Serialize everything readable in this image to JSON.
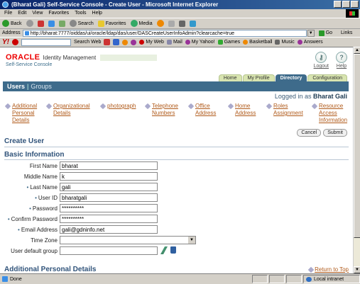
{
  "window": {
    "title": "(Bharat Gali) Self-Service Console - Create User - Microsoft Internet Explorer"
  },
  "menu": [
    "File",
    "Edit",
    "View",
    "Favorites",
    "Tools",
    "Help"
  ],
  "toolbar": {
    "back": "Back",
    "search": "Search",
    "favorites": "Favorites",
    "media": "Media"
  },
  "address": {
    "label": "Address",
    "url": "http://bharat:7777/oiddas/ui/oracle/ldap/das/user/DASCreateUserInfoAdmin?clearcache=true",
    "go": "Go",
    "links": "Links"
  },
  "yahoo": {
    "search_web": "Search Web",
    "my_web": "My Web",
    "mail": "Mail",
    "my_yahoo": "My Yahoo!",
    "games": "Games",
    "basketball": "Basketball",
    "music": "Music",
    "answers": "Answers"
  },
  "app": {
    "brand_oracle": "ORACLE",
    "brand_product": "Identity Management",
    "console": "Self-Service Console",
    "logout": "Logout",
    "help": "Help",
    "tabs": [
      "Home",
      "My Profile",
      "Directory",
      "Configuration"
    ],
    "subnav_users": "Users",
    "subnav_sep": "|",
    "subnav_groups": "Groups",
    "logged_in_prefix": "Logged in as",
    "logged_in_user": "Bharat Gali",
    "steps": [
      "Additional Personal Details",
      "Organizational Details",
      "photograph",
      "Telephone Numbers",
      "Office Address",
      "Home Address",
      "Roles Assignment",
      "Resource Access Information"
    ],
    "cancel": "Cancel",
    "submit": "Submit",
    "page_title": "Create User",
    "basic_info": "Basic Information",
    "additional_details": "Additional Personal Details",
    "return_to_top": "Return to Top",
    "fields": [
      {
        "label": "First Name",
        "value": "bharat",
        "required": false
      },
      {
        "label": "Middle Name",
        "value": "k",
        "required": false
      },
      {
        "label": "Last Name",
        "value": "gali",
        "required": true
      },
      {
        "label": "User ID",
        "value": "bharatgali",
        "required": true
      },
      {
        "label": "Password",
        "value": "**********",
        "required": true
      },
      {
        "label": "Confirm Password",
        "value": "**********",
        "required": true
      },
      {
        "label": "Email Address",
        "value": "gali@gdninfo.net",
        "required": true
      }
    ],
    "time_zone_label": "Time Zone",
    "time_zone_value": "",
    "group_label": "User default group",
    "group_value": ""
  },
  "status": {
    "text": "Done",
    "zone": "Local intranet"
  },
  "colors": {
    "title_bar": "#0a246a",
    "oracle_red": "#e00000",
    "nav_blue": "#3e6b8b",
    "tab_green": "#d8e4b0",
    "link_orange": "#b05a1a"
  }
}
